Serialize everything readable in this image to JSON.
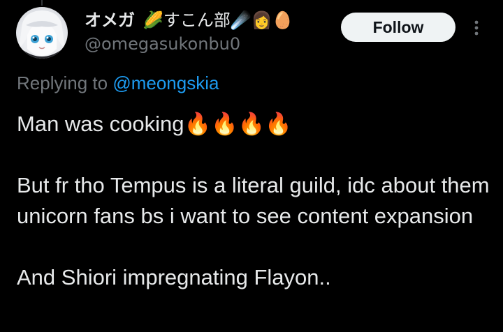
{
  "post": {
    "author": {
      "display_name": "オメガ",
      "display_name_emojis": "🌽すこん部☄️👩🥚",
      "handle": "@omegasukonbu0"
    },
    "follow_label": "Follow",
    "more_icon": "more-vertical-icon",
    "replying_prefix": "Replying to",
    "replying_to": "@meongskia",
    "body": {
      "line1": "Man was cooking🔥🔥🔥🔥",
      "paragraph2": "But fr tho Tempus is a literal guild, idc about them unicorn fans bs i want to see content expansion",
      "paragraph3": "And Shiori impregnating Flayon.."
    }
  },
  "colors": {
    "background": "#000000",
    "text_primary": "#e7e9ea",
    "text_secondary": "#71767b",
    "link": "#1d9bf0",
    "button_bg": "#eff3f4",
    "button_text": "#0f1419"
  }
}
